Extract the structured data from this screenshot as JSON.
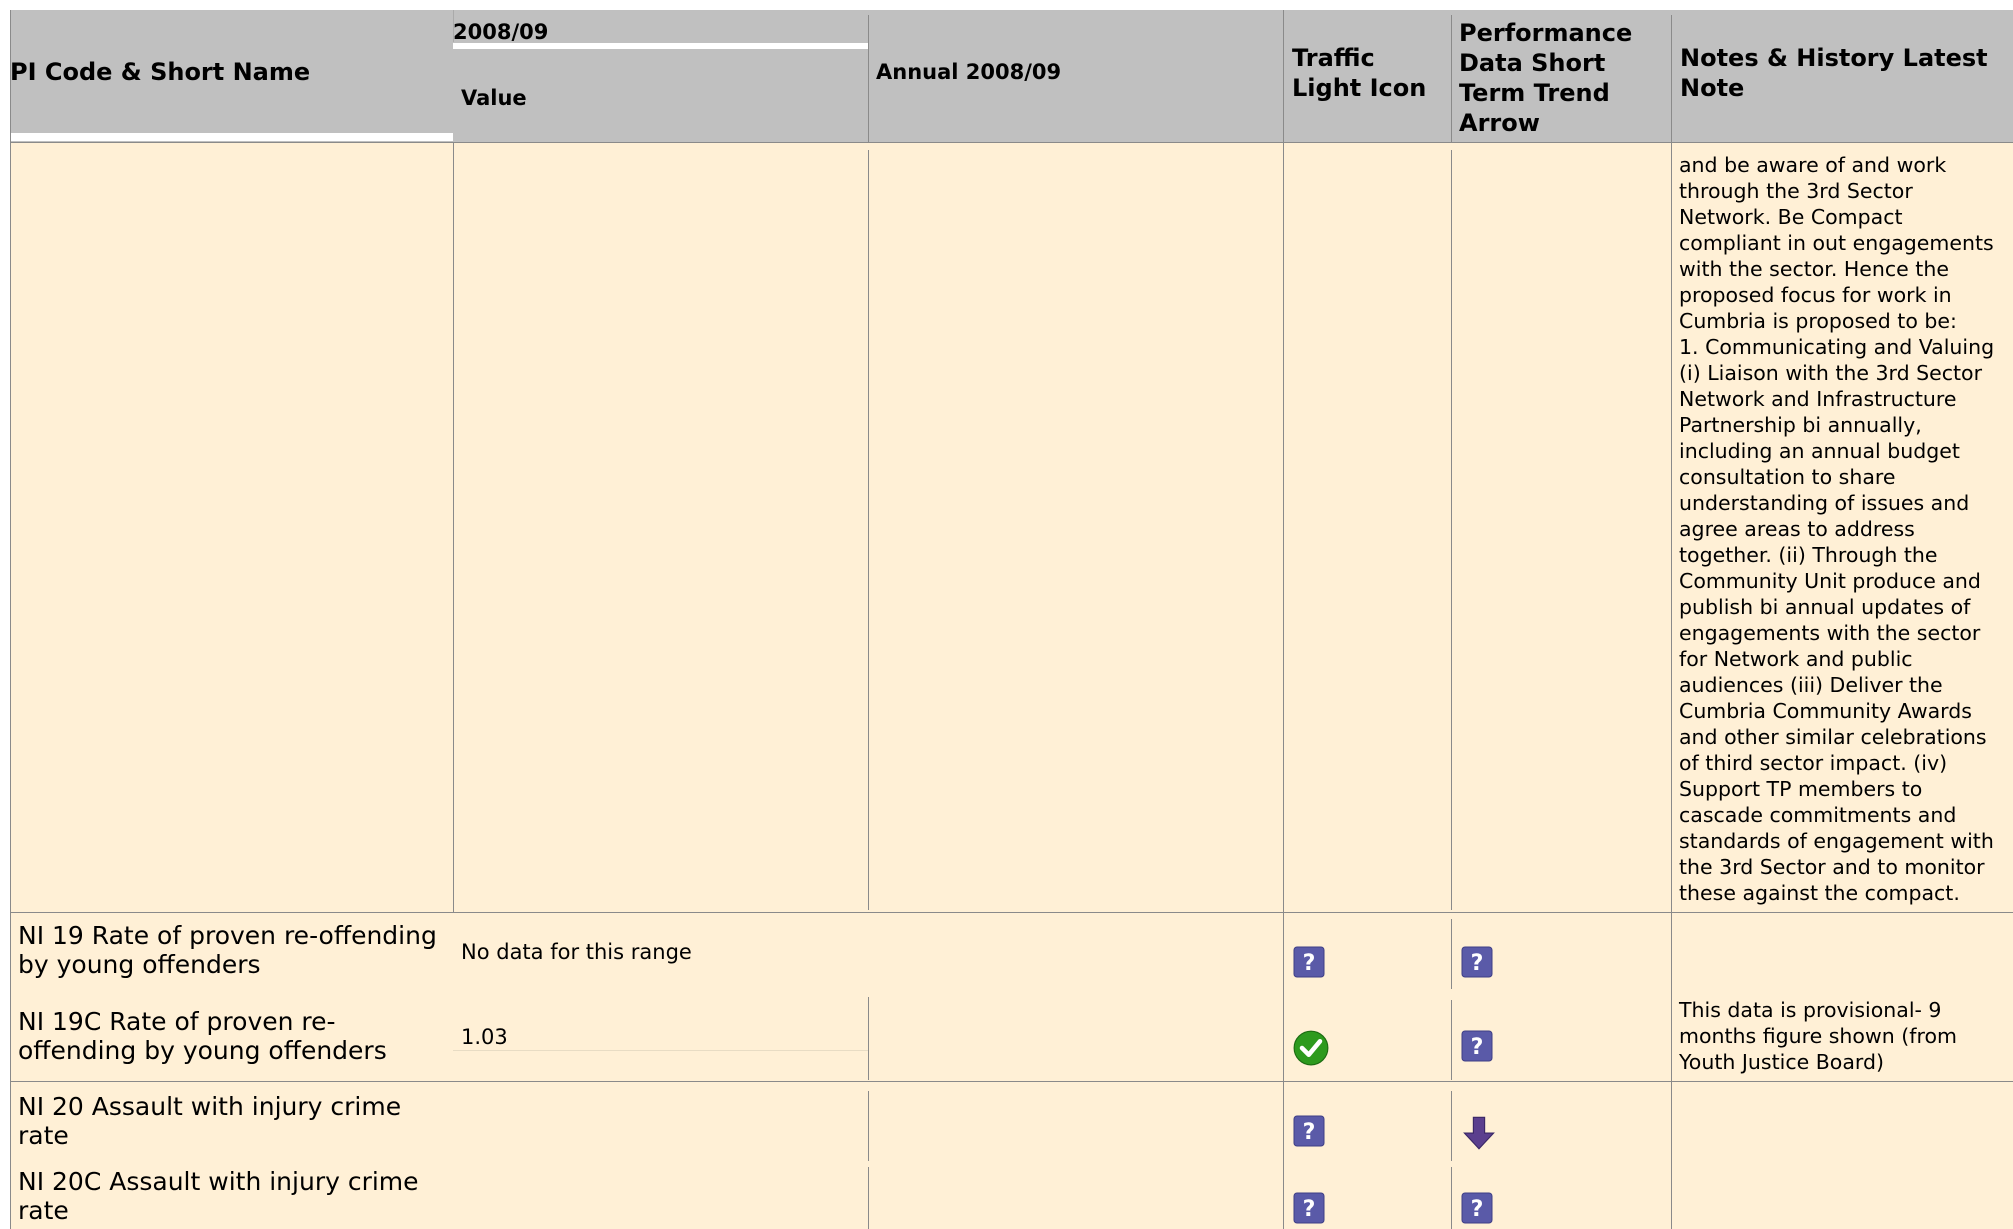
{
  "header": {
    "col_pi": "PI Code & Short Name",
    "period": "2008/09",
    "col_value": "Value",
    "col_annual": "Annual 2008/09",
    "col_traffic": "Traffic\nLight Icon",
    "col_trend": "Performance\nData Short\nTerm Trend\nArrow",
    "col_notes": "Notes & History Latest\nNote"
  },
  "rows": {
    "continuation": {
      "note": "and be aware of and work\nthrough the 3rd Sector\nNetwork. Be Compact\ncompliant in out engagements\nwith the sector. Hence the\nproposed focus for work in\nCumbria is proposed to be:\n1. Communicating and Valuing\n(i) Liaison with the 3rd Sector\nNetwork and Infrastructure\nPartnership bi annually,\nincluding an annual budget\nconsultation to share\nunderstanding of issues and\nagree areas to address\ntogether. (ii) Through the\nCommunity Unit produce and\npublish bi annual updates of\nengagements with the sector\nfor Network and public\naudiences (iii) Deliver the\nCumbria Community Awards\nand other similar celebrations\nof third sector impact. (iv)\nSupport TP members to\ncascade commitments and\nstandards of engagement with\nthe 3rd Sector and to monitor\nthese against the compact."
    },
    "ni19": {
      "name": "NI 19 Rate of proven re-offending\nby young offenders",
      "value": "No data for this range",
      "traffic_icon": "question-icon",
      "trend_icon": "question-icon"
    },
    "ni19c": {
      "name": "NI 19C Rate of proven re-\noffending by young offenders",
      "value": "1.03",
      "traffic_icon": "green-check-icon",
      "trend_icon": "question-icon",
      "note": "This data is provisional- 9\nmonths figure shown (from\nYouth Justice Board)"
    },
    "ni20": {
      "name": "NI 20 Assault with injury crime\nrate",
      "traffic_icon": "question-icon",
      "trend_icon": "down-arrow-icon"
    },
    "ni20c": {
      "name": "NI 20C Assault with injury crime\nrate",
      "traffic_icon": "question-icon",
      "trend_icon": "question-icon"
    }
  },
  "colors": {
    "header_bg": "#c0c0c0",
    "row_bg": "#fff0d6",
    "question_icon": "#5a5aa8",
    "check_icon": "#2d9a1e",
    "arrow_icon": "#5b3f8e"
  }
}
